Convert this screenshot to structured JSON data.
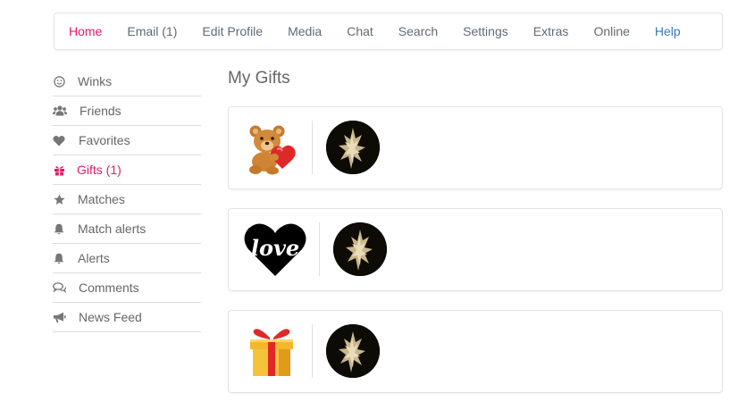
{
  "nav": {
    "items": [
      {
        "label": "Home"
      },
      {
        "label": "Email (1)"
      },
      {
        "label": "Edit Profile"
      },
      {
        "label": "Media"
      },
      {
        "label": "Chat"
      },
      {
        "label": "Search"
      },
      {
        "label": "Settings"
      },
      {
        "label": "Extras"
      },
      {
        "label": "Online"
      },
      {
        "label": "Help"
      }
    ],
    "active_label": "Home"
  },
  "sidebar": {
    "items": [
      {
        "label": "Winks",
        "icon": "smile-icon"
      },
      {
        "label": "Friends",
        "icon": "users-icon"
      },
      {
        "label": "Favorites",
        "icon": "heart-icon"
      },
      {
        "label": "Gifts (1)",
        "icon": "gift-icon"
      },
      {
        "label": "Matches",
        "icon": "star-icon"
      },
      {
        "label": "Match alerts",
        "icon": "bell-icon"
      },
      {
        "label": "Alerts",
        "icon": "bell-icon"
      },
      {
        "label": "Comments",
        "icon": "comments-icon"
      },
      {
        "label": "News Feed",
        "icon": "bullhorn-icon"
      }
    ],
    "active_label": "Gifts (1)"
  },
  "main": {
    "title": "My Gifts",
    "gifts": [
      {
        "gift_icon": "teddy-bear-heart-icon"
      },
      {
        "gift_icon": "love-heart-icon",
        "gift_text": "love"
      },
      {
        "gift_icon": "gift-box-icon"
      }
    ]
  },
  "colors": {
    "accent": "#e5196a",
    "link_blue": "#3a7ab8",
    "text": "#666666",
    "border": "#e3e3e3"
  }
}
